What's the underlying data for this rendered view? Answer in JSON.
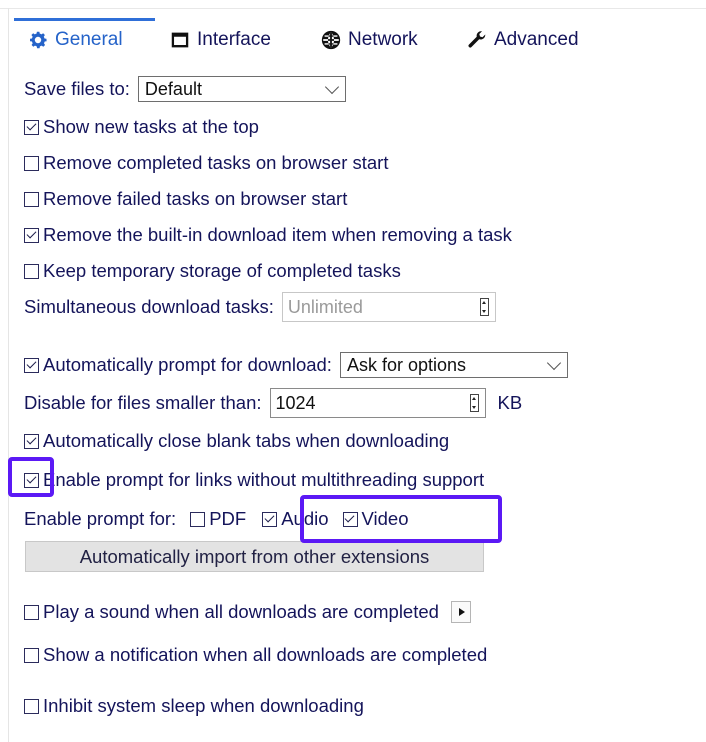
{
  "tabs": [
    {
      "label": "General",
      "icon": "gear-icon",
      "active": true
    },
    {
      "label": "Interface",
      "icon": "window-icon",
      "active": false
    },
    {
      "label": "Network",
      "icon": "globe-icon",
      "active": false
    },
    {
      "label": "Advanced",
      "icon": "wrench-icon",
      "active": false
    }
  ],
  "save_files": {
    "label": "Save files to:",
    "value": "Default"
  },
  "options": {
    "show_new_tasks_top": {
      "label": "Show new tasks at the top",
      "checked": true
    },
    "remove_completed": {
      "label": "Remove completed tasks on browser start",
      "checked": false
    },
    "remove_failed": {
      "label": "Remove failed tasks on browser start",
      "checked": false
    },
    "remove_builtin": {
      "label": "Remove the built-in download item when removing a task",
      "checked": true
    },
    "keep_temp": {
      "label": "Keep temporary storage of completed tasks",
      "checked": false
    }
  },
  "simultaneous": {
    "label": "Simultaneous download tasks:",
    "value": "Unlimited"
  },
  "auto_prompt": {
    "label": "Automatically prompt for download:",
    "checked": true,
    "value": "Ask for options"
  },
  "disable_smaller": {
    "label": "Disable for files smaller than:",
    "value": "1024",
    "unit": "KB"
  },
  "auto_close_blank": {
    "label": "Automatically close blank tabs when downloading",
    "checked": true
  },
  "enable_prompt_links": {
    "label": "Enable prompt for links without multithreading support",
    "checked": true
  },
  "enable_prompt_for": {
    "label": "Enable prompt for:",
    "pdf": {
      "label": "PDF",
      "checked": false
    },
    "audio": {
      "label": "Audio",
      "checked": true
    },
    "video": {
      "label": "Video",
      "checked": true
    }
  },
  "import_button": {
    "label": "Automatically import from other extensions"
  },
  "play_sound": {
    "label": "Play a sound when all downloads are completed",
    "checked": false
  },
  "show_notification": {
    "label": "Show a notification when all downloads are completed",
    "checked": false
  },
  "inhibit_sleep": {
    "label": "Inhibit system sleep when downloading",
    "checked": false
  },
  "highlight_color": "#5b19f5",
  "accent_color": "#2563c9"
}
